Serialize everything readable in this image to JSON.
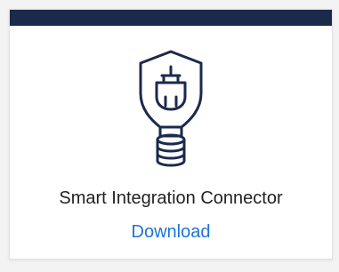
{
  "card": {
    "title": "Smart Integration Connector",
    "action_label": "Download",
    "icon": "connector-plug-icon"
  },
  "colors": {
    "top_bar": "#1b2a4b",
    "icon": "#1b2a4b",
    "link": "#1e73d6"
  }
}
